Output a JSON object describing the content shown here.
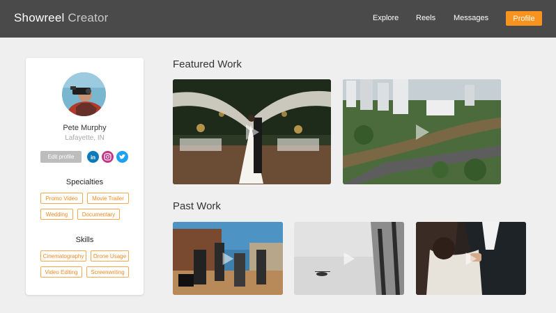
{
  "header": {
    "brand_main": "Showreel",
    "brand_sub": "Creator",
    "nav": [
      "Explore",
      "Reels",
      "Messages"
    ],
    "profile_label": "Profile",
    "accent": "#f7931e",
    "bar_color": "#4a4a4a"
  },
  "profile": {
    "name": "Pete Murphy",
    "location": "Lafayette, IN",
    "edit_label": "Edit profile",
    "social_icons": [
      "linkedin-icon",
      "instagram-icon",
      "twitter-icon"
    ],
    "specialties_title": "Specialties",
    "specialties": [
      "Promo Video",
      "Movie Trailer",
      "Wedding",
      "Documentary"
    ],
    "skills_title": "Skills",
    "skills": [
      "Cinematography",
      "Drone Usage",
      "Video Editing",
      "Screenwriting"
    ]
  },
  "featured": {
    "title": "Featured Work",
    "items": [
      "wedding-arch-thumbnail",
      "city-aerial-thumbnail"
    ]
  },
  "past": {
    "title": "Past Work",
    "items": [
      "film-set-thumbnail",
      "helicopter-building-thumbnail",
      "couple-dance-thumbnail"
    ]
  }
}
